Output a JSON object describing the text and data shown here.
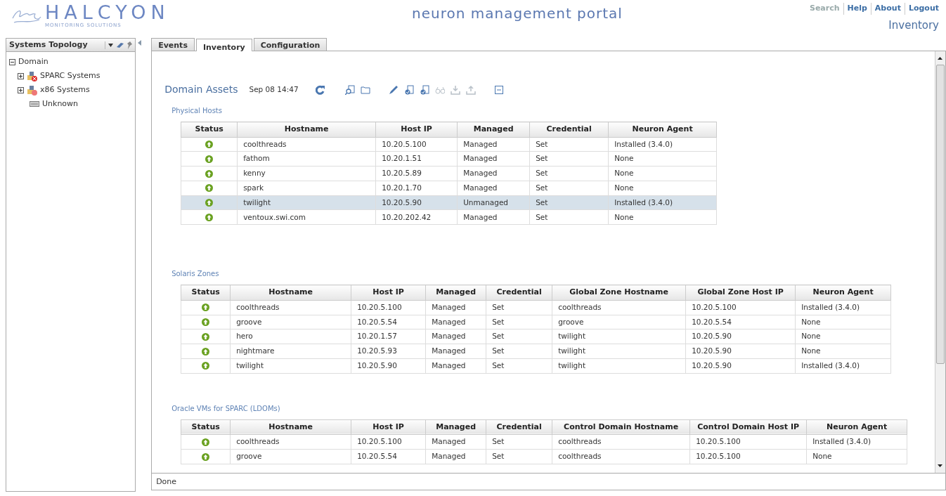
{
  "header": {
    "logo_text": "HALCYON",
    "logo_tagline": "MONITORING SOLUTIONS",
    "title": "neuron management portal",
    "links": [
      {
        "label": "Search",
        "disabled": true
      },
      {
        "label": "Help",
        "disabled": false
      },
      {
        "label": "About",
        "disabled": false
      },
      {
        "label": "Logout",
        "disabled": false
      }
    ],
    "page_name": "Inventory"
  },
  "sidebar": {
    "title": "Systems Topology",
    "tree": [
      {
        "label": "Domain",
        "expanded": true,
        "children": [
          {
            "label": "SPARC Systems",
            "kind": "group-error",
            "expanded": false
          },
          {
            "label": "x86 Systems",
            "kind": "group-warning",
            "expanded": false
          },
          {
            "label": "Unknown",
            "kind": "unknown"
          }
        ]
      }
    ]
  },
  "tabs": [
    {
      "label": "Events",
      "selected": false
    },
    {
      "label": "Inventory",
      "selected": true
    },
    {
      "label": "Configuration",
      "selected": false
    }
  ],
  "assets": {
    "title": "Domain Assets",
    "timestamp": "Sep 08 14:47",
    "toolbar": [
      {
        "kind": "refresh",
        "disabled": false
      },
      {
        "kind": "find",
        "disabled": false
      },
      {
        "kind": "folder",
        "disabled": false
      },
      {
        "kind": "edit",
        "disabled": false
      },
      {
        "kind": "doc-check",
        "disabled": false
      },
      {
        "kind": "doc-check",
        "disabled": false
      },
      {
        "kind": "view",
        "disabled": true
      },
      {
        "kind": "download",
        "disabled": true
      },
      {
        "kind": "upload",
        "disabled": true
      },
      {
        "kind": "collapse",
        "disabled": false
      }
    ],
    "sections": [
      {
        "title": "Physical Hosts",
        "columns": [
          "Status",
          "Hostname",
          "Host IP",
          "Managed",
          "Credential",
          "Neuron Agent"
        ],
        "rows": [
          {
            "kind": "up",
            "selected": false,
            "cells": [
              "",
              "coolthreads",
              "10.20.5.100",
              "Managed",
              "Set",
              "Installed (3.4.0)"
            ]
          },
          {
            "kind": "up",
            "selected": false,
            "cells": [
              "",
              "fathom",
              "10.20.1.51",
              "Managed",
              "Set",
              "None"
            ]
          },
          {
            "kind": "up",
            "selected": false,
            "cells": [
              "",
              "kenny",
              "10.20.5.89",
              "Managed",
              "Set",
              "None"
            ]
          },
          {
            "kind": "up",
            "selected": false,
            "cells": [
              "",
              "spark",
              "10.20.1.70",
              "Managed",
              "Set",
              "None"
            ]
          },
          {
            "kind": "up",
            "selected": true,
            "cells": [
              "",
              "twilight",
              "10.20.5.90",
              "Unmanaged",
              "Set",
              "Installed (3.4.0)"
            ]
          },
          {
            "kind": "up",
            "selected": false,
            "cells": [
              "",
              "ventoux.swi.com",
              "10.20.202.42",
              "Managed",
              "Set",
              "None"
            ]
          }
        ]
      },
      {
        "title": "Solaris Zones",
        "columns": [
          "Status",
          "Hostname",
          "Host IP",
          "Managed",
          "Credential",
          "Global Zone Hostname",
          "Global Zone Host IP",
          "Neuron Agent"
        ],
        "rows": [
          {
            "kind": "up",
            "selected": false,
            "cells": [
              "",
              "coolthreads",
              "10.20.5.100",
              "Managed",
              "Set",
              "coolthreads",
              "10.20.5.100",
              "Installed (3.4.0)"
            ]
          },
          {
            "kind": "up",
            "selected": false,
            "cells": [
              "",
              "groove",
              "10.20.5.54",
              "Managed",
              "Set",
              "groove",
              "10.20.5.54",
              "None"
            ]
          },
          {
            "kind": "up",
            "selected": false,
            "cells": [
              "",
              "hero",
              "10.20.1.57",
              "Managed",
              "Set",
              "twilight",
              "10.20.5.90",
              "None"
            ]
          },
          {
            "kind": "up",
            "selected": false,
            "cells": [
              "",
              "nightmare",
              "10.20.5.93",
              "Managed",
              "Set",
              "twilight",
              "10.20.5.90",
              "None"
            ]
          },
          {
            "kind": "up",
            "selected": false,
            "cells": [
              "",
              "twilight",
              "10.20.5.90",
              "Managed",
              "Set",
              "twilight",
              "10.20.5.90",
              "Installed (3.4.0)"
            ]
          }
        ]
      },
      {
        "title": "Oracle VMs for SPARC (LDOMs)",
        "columns": [
          "Status",
          "Hostname",
          "Host IP",
          "Managed",
          "Credential",
          "Control Domain Hostname",
          "Control Domain Host IP",
          "Neuron Agent"
        ],
        "rows": [
          {
            "kind": "up",
            "selected": false,
            "cells": [
              "",
              "coolthreads",
              "10.20.5.100",
              "Managed",
              "Set",
              "coolthreads",
              "10.20.5.100",
              "Installed (3.4.0)"
            ]
          },
          {
            "kind": "up",
            "selected": false,
            "cells": [
              "",
              "groove",
              "10.20.5.54",
              "Managed",
              "Set",
              "coolthreads",
              "10.20.5.100",
              "None"
            ]
          }
        ]
      }
    ]
  },
  "status_bar": "Done"
}
